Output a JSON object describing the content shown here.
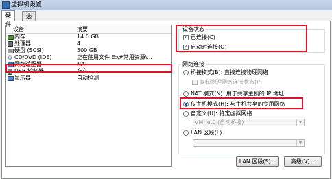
{
  "window": {
    "title": "虚拟机设置"
  },
  "tabs": [
    {
      "label": "硬件"
    },
    {
      "label": "选项"
    }
  ],
  "devices": {
    "header": {
      "device": "设备",
      "summary": "摘要"
    },
    "rows": [
      {
        "name": "内存",
        "summary": "14.0 GB",
        "icon": "memory-icon"
      },
      {
        "name": "处理器",
        "summary": "4",
        "icon": "processor-icon"
      },
      {
        "name": "硬盘 (SCSI)",
        "summary": "500 GB",
        "icon": "hard-disk-icon"
      },
      {
        "name": "CD/DVD (IDE)",
        "summary": "正在使用文件 E:\\#常用资源\\...",
        "icon": "cd-dvd-icon"
      },
      {
        "name": "网络适配器",
        "summary": "NAT",
        "icon": "network-adapter-icon"
      },
      {
        "name": "USB 控制器",
        "summary": "存在",
        "icon": "usb-icon"
      },
      {
        "name": "显示器",
        "summary": "自动检测",
        "icon": "display-icon"
      }
    ]
  },
  "device_status": {
    "title": "设备状态",
    "connected": {
      "label": "已连接(C)",
      "checked": true
    },
    "connect_on_power": {
      "label": "启动时连接(O)",
      "checked": true
    }
  },
  "network": {
    "title": "网络连接",
    "bridged": {
      "label": "桥接模式(B): 直接连接物理网络",
      "selected": false
    },
    "replicate": {
      "label": "复制物理网络连接状态(P)",
      "checked": false
    },
    "nat": {
      "label": "NAT 模式(N): 用于共享主机的 IP 地址",
      "selected": false
    },
    "hostonly": {
      "label": "仅主机模式(H): 与主机共享的专用网络",
      "selected": true
    },
    "custom": {
      "label": "自定义(U): 特定虚拟网络",
      "selected": false
    },
    "custom_value": "VMnet0 (自动桥接)",
    "lan": {
      "label": "LAN 区段(L):",
      "selected": false
    },
    "lan_value": ""
  },
  "buttons": {
    "lan_segments": "LAN 区段(S)...",
    "advanced": "高级(V)..."
  },
  "colors": {
    "highlight": "#e0152a",
    "titlebar": "#c9d6e8"
  }
}
